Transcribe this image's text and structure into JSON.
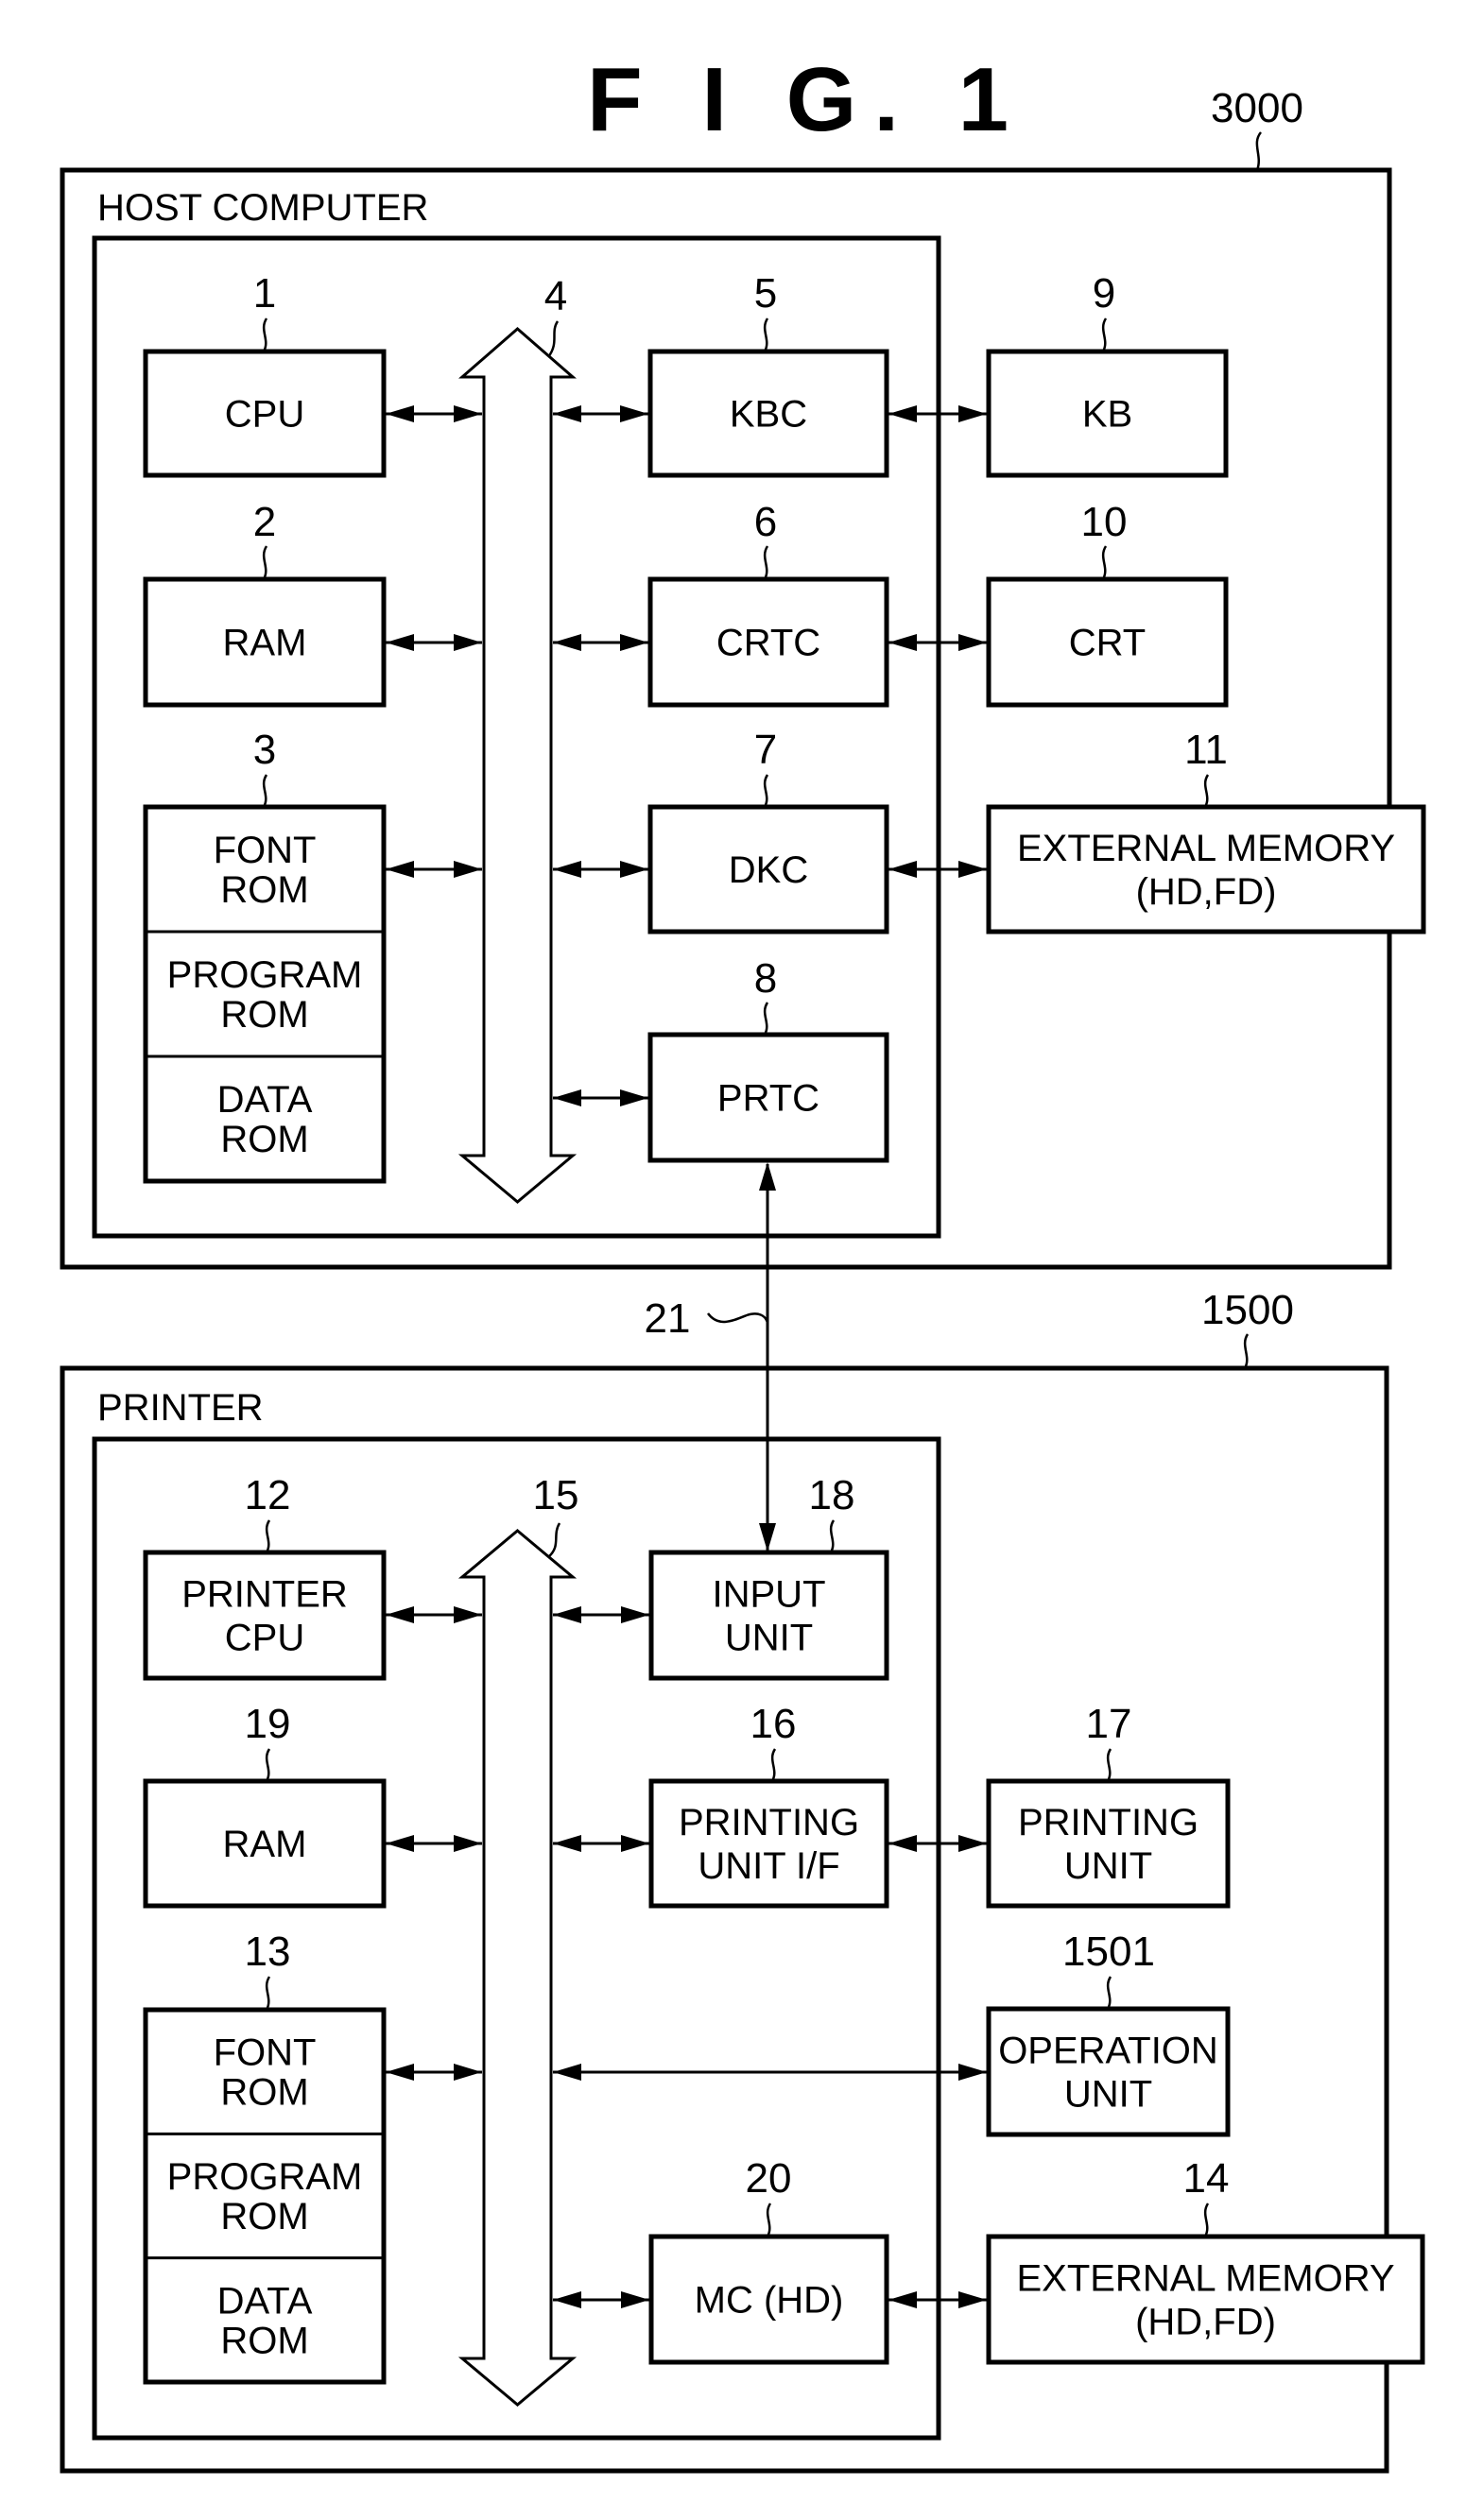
{
  "figure": {
    "title": "F I G. 1",
    "host": {
      "ref": "3000",
      "label": "HOST COMPUTER",
      "bus_ref": "4",
      "blocks": {
        "cpu": {
          "ref": "1",
          "lines": [
            "CPU"
          ]
        },
        "ram": {
          "ref": "2",
          "lines": [
            "RAM"
          ]
        },
        "rom": {
          "ref": "3",
          "sections": [
            [
              "FONT",
              "ROM"
            ],
            [
              "PROGRAM",
              "ROM"
            ],
            [
              "DATA",
              "ROM"
            ]
          ]
        },
        "kbc": {
          "ref": "5",
          "lines": [
            "KBC"
          ]
        },
        "crtc": {
          "ref": "6",
          "lines": [
            "CRTC"
          ]
        },
        "dkc": {
          "ref": "7",
          "lines": [
            "DKC"
          ]
        },
        "prtc": {
          "ref": "8",
          "lines": [
            "PRTC"
          ]
        },
        "kb": {
          "ref": "9",
          "lines": [
            "KB"
          ]
        },
        "crt": {
          "ref": "10",
          "lines": [
            "CRT"
          ]
        },
        "extmem": {
          "ref": "11",
          "lines": [
            "EXTERNAL MEMORY",
            "(HD,FD)"
          ]
        }
      }
    },
    "link": {
      "ref": "21"
    },
    "printer": {
      "ref": "1500",
      "label": "PRINTER",
      "bus_ref": "15",
      "blocks": {
        "cpu": {
          "ref": "12",
          "lines": [
            "PRINTER",
            "CPU"
          ]
        },
        "ram": {
          "ref": "19",
          "lines": [
            "RAM"
          ]
        },
        "rom": {
          "ref": "13",
          "sections": [
            [
              "FONT",
              "ROM"
            ],
            [
              "PROGRAM",
              "ROM"
            ],
            [
              "DATA",
              "ROM"
            ]
          ]
        },
        "input": {
          "ref": "18",
          "lines": [
            "INPUT",
            "UNIT"
          ]
        },
        "pif": {
          "ref": "16",
          "lines": [
            "PRINTING",
            "UNIT I/F"
          ]
        },
        "mc": {
          "ref": "20",
          "lines": [
            "MC (HD)"
          ]
        },
        "punit": {
          "ref": "17",
          "lines": [
            "PRINTING",
            "UNIT"
          ]
        },
        "opunit": {
          "ref": "1501",
          "lines": [
            "OPERATION",
            "UNIT"
          ]
        },
        "extmem": {
          "ref": "14",
          "lines": [
            "EXTERNAL MEMORY",
            "(HD,FD)"
          ]
        }
      }
    }
  }
}
